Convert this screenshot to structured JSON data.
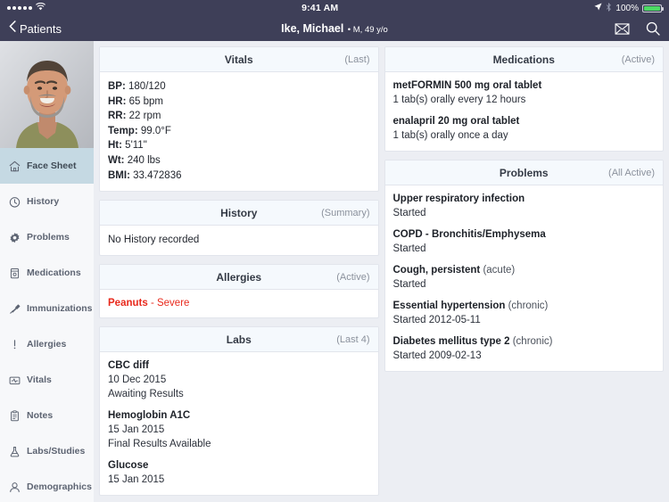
{
  "status_bar": {
    "signal_dots": 5,
    "wifi_icon": "wifi-icon",
    "time": "9:41 AM",
    "location_icon": "location-arrow-icon",
    "bluetooth_icon": "bluetooth-icon",
    "battery_percent": "100%",
    "battery_icon": "battery-full-icon"
  },
  "nav": {
    "back_label": "Patients",
    "back_icon": "chevron-left-icon",
    "patient_name": "Ike, Michael",
    "patient_meta": "• M, 49 y/o",
    "mail_icon": "envelope-icon",
    "search_icon": "search-icon"
  },
  "sidebar": {
    "avatar": "patient-photo",
    "items": [
      {
        "label": "Face Sheet",
        "icon": "home-icon",
        "active": true
      },
      {
        "label": "History",
        "icon": "clock-icon",
        "active": false
      },
      {
        "label": "Problems",
        "icon": "gear-icon",
        "active": false
      },
      {
        "label": "Medications",
        "icon": "pill-bottle-icon",
        "active": false
      },
      {
        "label": "Immunizations",
        "icon": "syringe-icon",
        "active": false
      },
      {
        "label": "Allergies",
        "icon": "exclamation-icon",
        "active": false
      },
      {
        "label": "Vitals",
        "icon": "vitals-monitor-icon",
        "active": false
      },
      {
        "label": "Notes",
        "icon": "clipboard-icon",
        "active": false
      },
      {
        "label": "Labs/Studies",
        "icon": "flask-icon",
        "active": false
      },
      {
        "label": "Demographics",
        "icon": "person-icon",
        "active": false
      }
    ]
  },
  "panels": {
    "vitals": {
      "title": "Vitals",
      "qualifier": "(Last)",
      "rows": [
        {
          "label": "BP:",
          "value": "180/120"
        },
        {
          "label": "HR:",
          "value": "65 bpm"
        },
        {
          "label": "RR:",
          "value": "22 rpm"
        },
        {
          "label": "Temp:",
          "value": "99.0°F"
        },
        {
          "label": "Ht:",
          "value": "5'11\""
        },
        {
          "label": "Wt:",
          "value": "240 lbs"
        },
        {
          "label": "BMI:",
          "value": "33.472836"
        }
      ]
    },
    "history": {
      "title": "History",
      "qualifier": "(Summary)",
      "empty_text": "No History recorded"
    },
    "allergies": {
      "title": "Allergies",
      "qualifier": "(Active)",
      "color": "#e8291c",
      "items": [
        {
          "name": "Peanuts",
          "separator": " - ",
          "severity": "Severe"
        }
      ]
    },
    "labs": {
      "title": "Labs",
      "qualifier": "(Last 4)",
      "items": [
        {
          "name": "CBC diff",
          "date": "10 Dec 2015",
          "status": "Awaiting Results"
        },
        {
          "name": "Hemoglobin A1C",
          "date": "15 Jan 2015",
          "status": "Final Results Available"
        },
        {
          "name": "Glucose",
          "date": "15 Jan 2015",
          "status": ""
        }
      ]
    },
    "medications": {
      "title": "Medications",
      "qualifier": "(Active)",
      "items": [
        {
          "name": "metFORMIN 500 mg oral tablet",
          "sig": "1 tab(s) orally every 12 hours"
        },
        {
          "name": "enalapril 20 mg oral tablet",
          "sig": "1 tab(s) orally once a day"
        }
      ]
    },
    "problems": {
      "title": "Problems",
      "qualifier": "(All Active)",
      "items": [
        {
          "name": "Upper respiratory infection",
          "qualifier": "",
          "started": "Started"
        },
        {
          "name": "COPD - Bronchitis/Emphysema",
          "qualifier": "",
          "started": "Started"
        },
        {
          "name": "Cough, persistent",
          "qualifier": " (acute)",
          "started": "Started"
        },
        {
          "name": "Essential hypertension",
          "qualifier": " (chronic)",
          "started": "Started 2012-05-11"
        },
        {
          "name": "Diabetes mellitus type 2",
          "qualifier": " (chronic)",
          "started": "Started 2009-02-13"
        }
      ]
    }
  }
}
